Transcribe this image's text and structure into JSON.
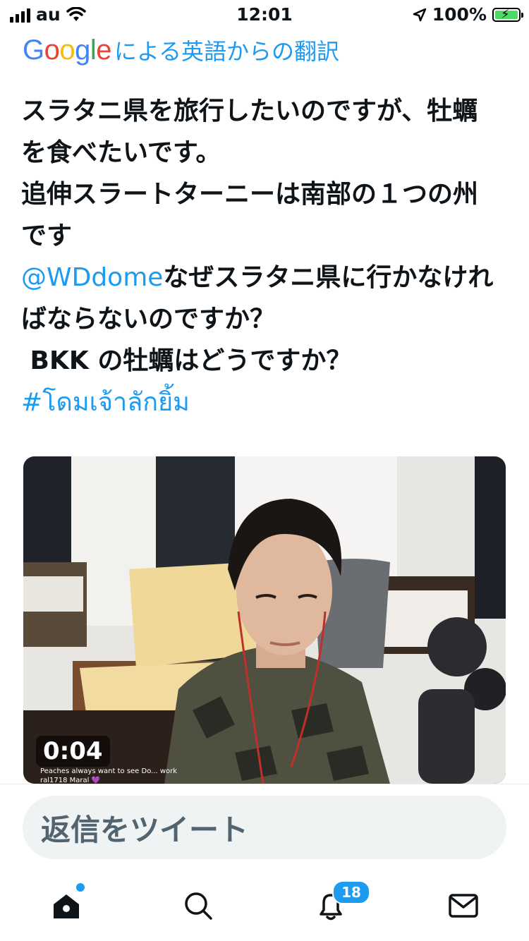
{
  "status_bar": {
    "carrier": "au",
    "time": "12:01",
    "battery": "100%"
  },
  "translation_header": {
    "logo": "Google",
    "text": "による英語からの翻訳"
  },
  "tweet": {
    "line1": "スラタニ県を旅行したいのですが、牡蠣を食べたいです。",
    "line2": "追伸スラートターニーは南部の１つの州です",
    "mention": "@WDdome",
    "line3": "なぜスラタニ県に行かなければならないのですか？",
    "line4": " BKK の牡蠣はどうですか？",
    "hashtag": "#โดมเจ้าลักยิ้ม"
  },
  "media": {
    "duration": "0:04",
    "chat_lines": [
      "Peaches always want to see Do... work",
      "ral1718  Maral 💜"
    ]
  },
  "reply": {
    "placeholder": "返信をツイート"
  },
  "tabbar": {
    "icons": [
      "home-icon",
      "search-icon",
      "bell-icon",
      "mail-icon"
    ],
    "notifications_count": "18"
  },
  "colors": {
    "accent": "#1d9bf0",
    "text": "#0f1419",
    "reply_bg": "#eff3f4"
  }
}
